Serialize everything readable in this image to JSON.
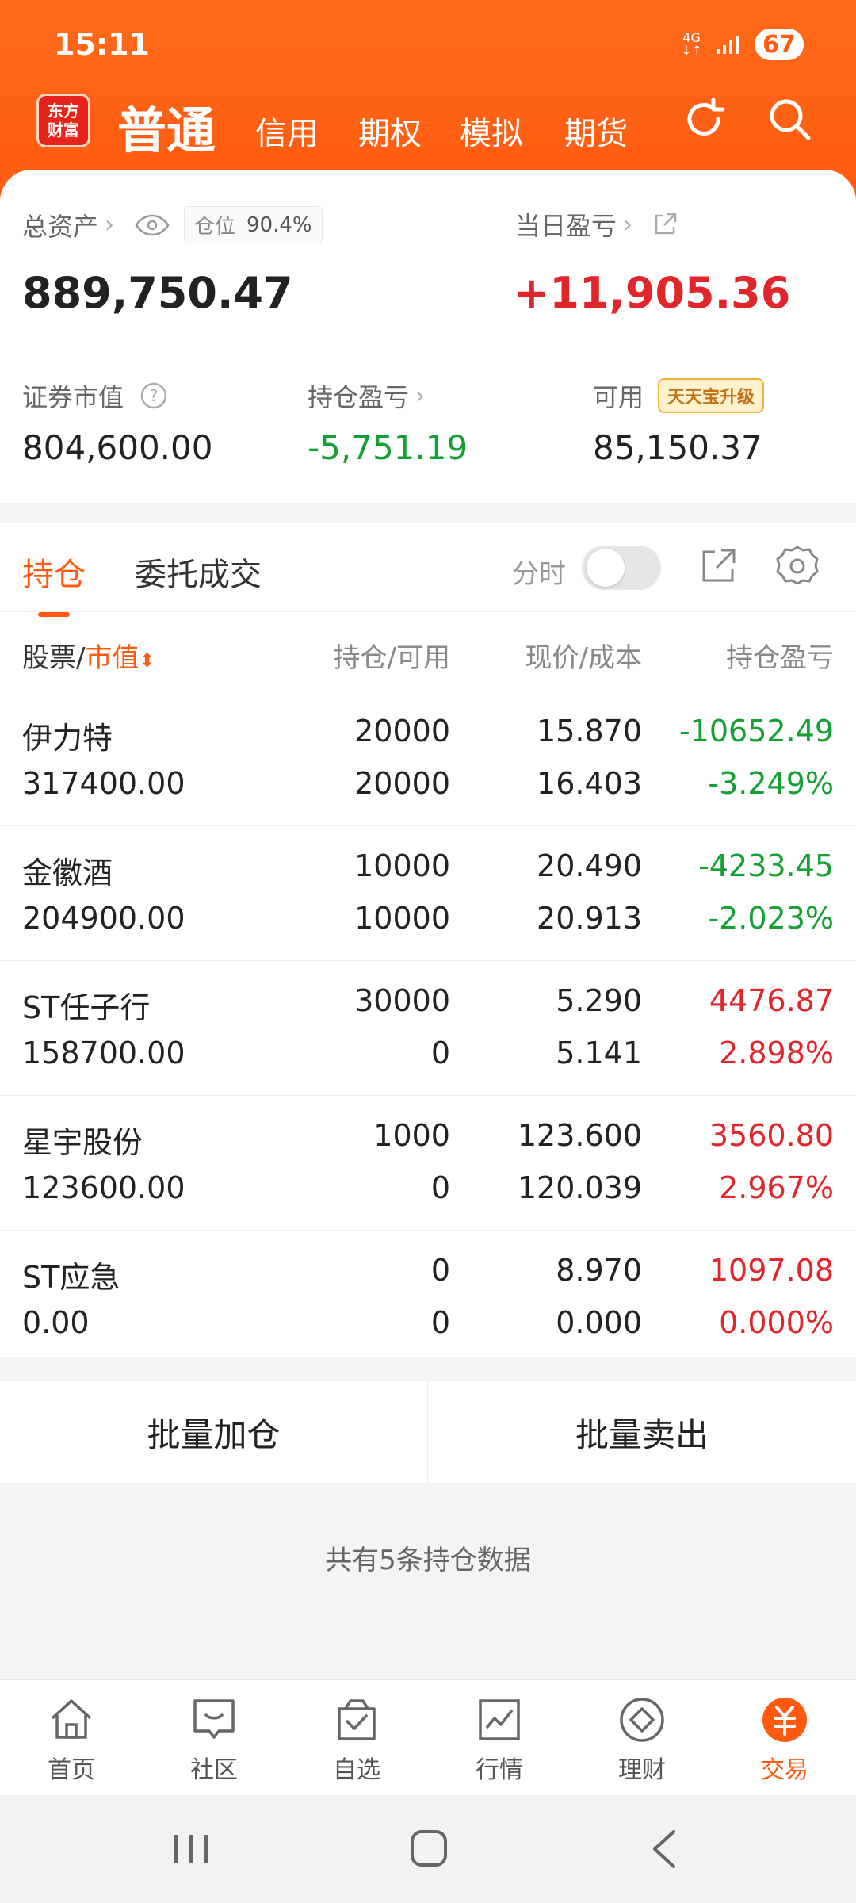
{
  "status": {
    "time": "15:11",
    "net": "4G",
    "battery": "67"
  },
  "header": {
    "logo_text": "东方\n财富",
    "active_tab": "普通",
    "tabs": [
      "信用",
      "期权",
      "模拟",
      "期货"
    ]
  },
  "summary": {
    "total_assets_label": "总资产",
    "position_label": "仓位",
    "position_value": "90.4%",
    "total_assets_value": "889,750.47",
    "daily_pnl_label": "当日盈亏",
    "daily_pnl_value": "+11,905.36",
    "market_value_label": "证券市值",
    "market_value": "804,600.00",
    "holding_pnl_label": "持仓盈亏",
    "holding_pnl_value": "-5,751.19",
    "available_label": "可用",
    "available_value": "85,150.37",
    "upgrade_label": "天天宝升级"
  },
  "holdings": {
    "tabs": [
      "持仓",
      "委托成交"
    ],
    "fenshi_label": "分时",
    "headers": {
      "col1_a": "股票",
      "col1_b": "市值",
      "col2": "持仓/可用",
      "col3": "现价/成本",
      "col4": "持仓盈亏"
    },
    "rows": [
      {
        "name": "伊力特",
        "market_value": "317400.00",
        "position": "20000",
        "available": "20000",
        "price": "15.870",
        "cost": "16.403",
        "pnl": "-10652.49",
        "pnl_pct": "-3.249%"
      },
      {
        "name": "金徽酒",
        "market_value": "204900.00",
        "position": "10000",
        "available": "10000",
        "price": "20.490",
        "cost": "20.913",
        "pnl": "-4233.45",
        "pnl_pct": "-2.023%"
      },
      {
        "name": "ST任子行",
        "market_value": "158700.00",
        "position": "30000",
        "available": "0",
        "price": "5.290",
        "cost": "5.141",
        "pnl": "4476.87",
        "pnl_pct": "2.898%"
      },
      {
        "name": "星宇股份",
        "market_value": "123600.00",
        "position": "1000",
        "available": "0",
        "price": "123.600",
        "cost": "120.039",
        "pnl": "3560.80",
        "pnl_pct": "2.967%"
      },
      {
        "name": "ST应急",
        "market_value": "0.00",
        "position": "0",
        "available": "0",
        "price": "8.970",
        "cost": "0.000",
        "pnl": "1097.08",
        "pnl_pct": "0.000%"
      }
    ]
  },
  "batch": {
    "add": "批量加仓",
    "sell": "批量卖出"
  },
  "footer_note": "共有5条持仓数据",
  "bottom_nav": [
    "首页",
    "社区",
    "自选",
    "行情",
    "理财",
    "交易"
  ],
  "colors": {
    "accent": "#ff5a10",
    "up": "#e0252b",
    "down": "#15a034"
  }
}
